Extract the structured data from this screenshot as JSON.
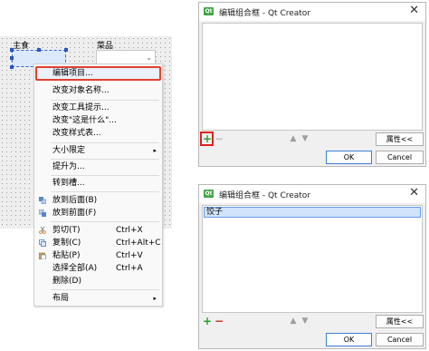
{
  "form": {
    "label_left": "主食",
    "label_right": "菜品",
    "combo_arrow_icon": "chevron-down-icon"
  },
  "context_menu": {
    "items": [
      {
        "label": "编辑项目...",
        "highlighted": true
      },
      {
        "label": "改变对象名称..."
      },
      {
        "label": "改变工具提示..."
      },
      {
        "label": "改变\"这是什么\"..."
      },
      {
        "label": "改变样式表..."
      },
      {
        "label": "大小限定",
        "submenu": true
      },
      {
        "label": "提升为..."
      },
      {
        "label": "转到槽..."
      },
      {
        "label": "放到后面(B)",
        "icon": "send-to-back-icon"
      },
      {
        "label": "放到前面(F)",
        "icon": "bring-to-front-icon"
      },
      {
        "label": "剪切(T)",
        "shortcut": "Ctrl+X",
        "icon": "cut-icon"
      },
      {
        "label": "复制(C)",
        "shortcut": "Ctrl+Alt+C",
        "icon": "copy-icon"
      },
      {
        "label": "粘贴(P)",
        "shortcut": "Ctrl+V",
        "icon": "paste-icon"
      },
      {
        "label": "选择全部(A)",
        "shortcut": "Ctrl+A"
      },
      {
        "label": "删除(D)"
      },
      {
        "label": "布局",
        "submenu": true
      }
    ],
    "submenu_arrow": "▸"
  },
  "dialog_empty": {
    "title": "编辑组合框 - Qt Creator",
    "close": "✕",
    "properties_button": "属性<<",
    "ok_button": "OK",
    "cancel_button": "Cancel",
    "add_icon": "+",
    "remove_icon": "−",
    "up_icon": "▲",
    "down_icon": "▼"
  },
  "dialog_filled": {
    "title": "编辑组合框 - Qt Creator",
    "close": "✕",
    "items": [
      "饺子"
    ],
    "properties_button": "属性<<",
    "ok_button": "OK",
    "cancel_button": "Cancel",
    "add_icon": "+",
    "remove_icon": "−",
    "up_icon": "▲",
    "down_icon": "▼"
  },
  "colors": {
    "highlight_border": "#e04030",
    "selection": "#cfe3fa",
    "add_green": "#2aa12a",
    "remove_red": "#c82828"
  }
}
